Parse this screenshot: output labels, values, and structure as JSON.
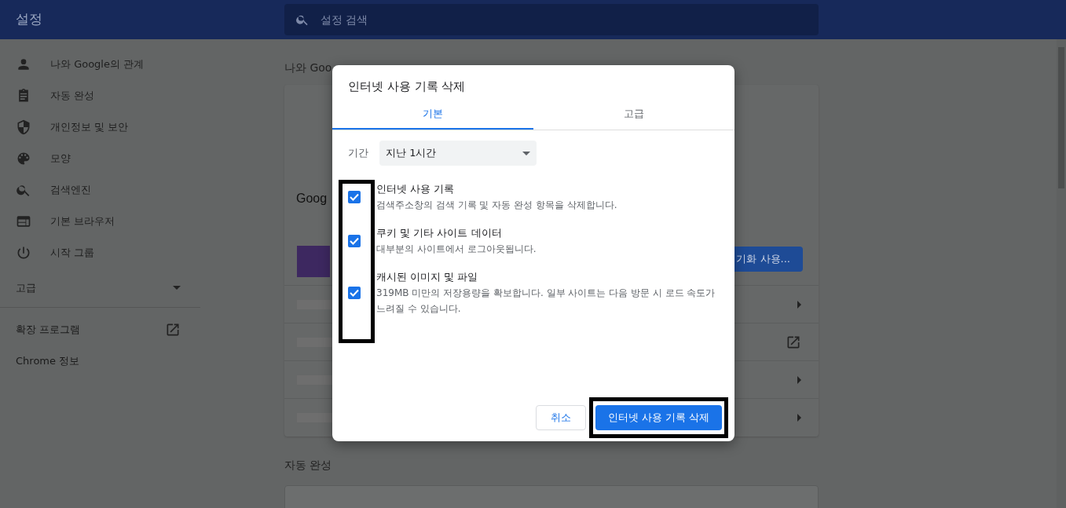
{
  "header": {
    "title": "설정",
    "search": {
      "placeholder": "설정 검색"
    }
  },
  "sidebar": {
    "items": [
      {
        "label": "나와 Google의 관계"
      },
      {
        "label": "자동 완성"
      },
      {
        "label": "개인정보 및 보안"
      },
      {
        "label": "모양"
      },
      {
        "label": "검색엔진"
      },
      {
        "label": "기본 브라우저"
      },
      {
        "label": "시작 그룹"
      }
    ],
    "advanced": {
      "label": "고급",
      "expanded": false
    },
    "links": [
      {
        "label": "확장 프로그램",
        "external": true
      },
      {
        "label": "Chrome 정보",
        "external": false
      }
    ]
  },
  "background": {
    "section_title": "나와 Goo",
    "card_title": "Goog",
    "sync_button": "기화 사용...",
    "rows": [
      {
        "kind": "arrow"
      },
      {
        "kind": "external"
      },
      {
        "kind": "arrow"
      },
      {
        "kind": "arrow"
      }
    ],
    "section_2_title": "자동 완성"
  },
  "dialog": {
    "title": "인터넷 사용 기록 삭제",
    "tabs": [
      {
        "label": "기본",
        "selected": true
      },
      {
        "label": "고급",
        "selected": false
      }
    ],
    "period": {
      "label": "기간",
      "value": "지난 1시간"
    },
    "items": [
      {
        "title": "인터넷 사용 기록",
        "description": "검색주소창의 검색 기록 및 자동 완성 항목을 삭제합니다.",
        "checked": true
      },
      {
        "title": "쿠키 및 기타 사이트 데이터",
        "description": "대부분의 사이트에서 로그아웃됩니다.",
        "checked": true
      },
      {
        "title": "캐시된 이미지 및 파일",
        "description": "319MB 미만의 저장용량을 확보합니다. 일부 사이트는 다음 방문 시 로드 속도가 느려질 수 있습니다.",
        "checked": true
      }
    ],
    "highlight_checkboxes": true,
    "cancel_button": "취소",
    "confirm_button": {
      "label": "인터넷 사용 기록 삭제",
      "highlighted": true
    }
  }
}
